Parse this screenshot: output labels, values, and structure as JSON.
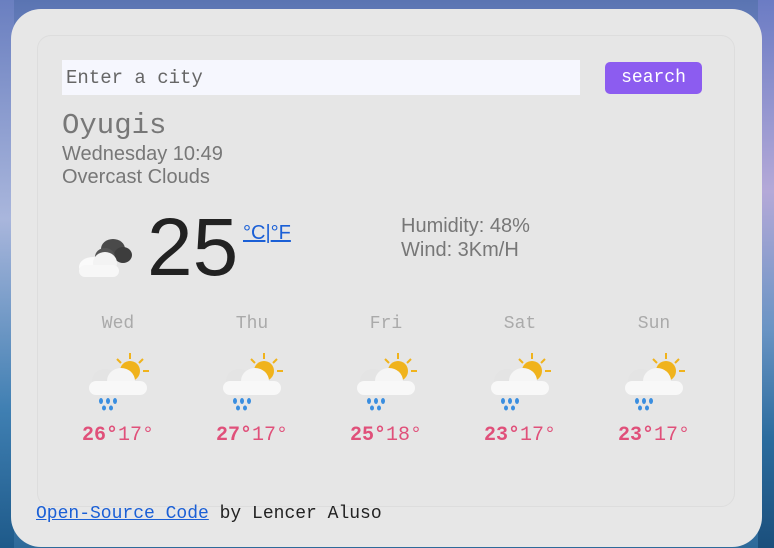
{
  "search": {
    "placeholder": "Enter a city",
    "value": "",
    "button_label": "search"
  },
  "current": {
    "city": "Oyugis",
    "datetime": "Wednesday 10:49",
    "description": "Overcast Clouds",
    "icon": "overcast-clouds-icon",
    "temperature": "25",
    "unit_celsius": "°C",
    "unit_separator": "|",
    "unit_fahrenheit": "°F",
    "humidity": "Humidity: 48%",
    "wind": "Wind: 3Km/H"
  },
  "forecast": [
    {
      "day": "Wed",
      "max": "26°",
      "min": "17°",
      "icon": "sun-cloud-rain-icon"
    },
    {
      "day": "Thu",
      "max": "27°",
      "min": "17°",
      "icon": "sun-cloud-rain-icon"
    },
    {
      "day": "Fri",
      "max": "25°",
      "min": "18°",
      "icon": "sun-cloud-rain-icon"
    },
    {
      "day": "Sat",
      "max": "23°",
      "min": "17°",
      "icon": "sun-cloud-rain-icon"
    },
    {
      "day": "Sun",
      "max": "23°",
      "min": "17°",
      "icon": "sun-cloud-rain-icon"
    }
  ],
  "footer": {
    "link_text": "Open-Source Code",
    "suffix": " by Lencer Aluso"
  },
  "colors": {
    "accent": "#8c5cf0",
    "temp_high": "#e0507a",
    "link": "#1a5fd6"
  }
}
